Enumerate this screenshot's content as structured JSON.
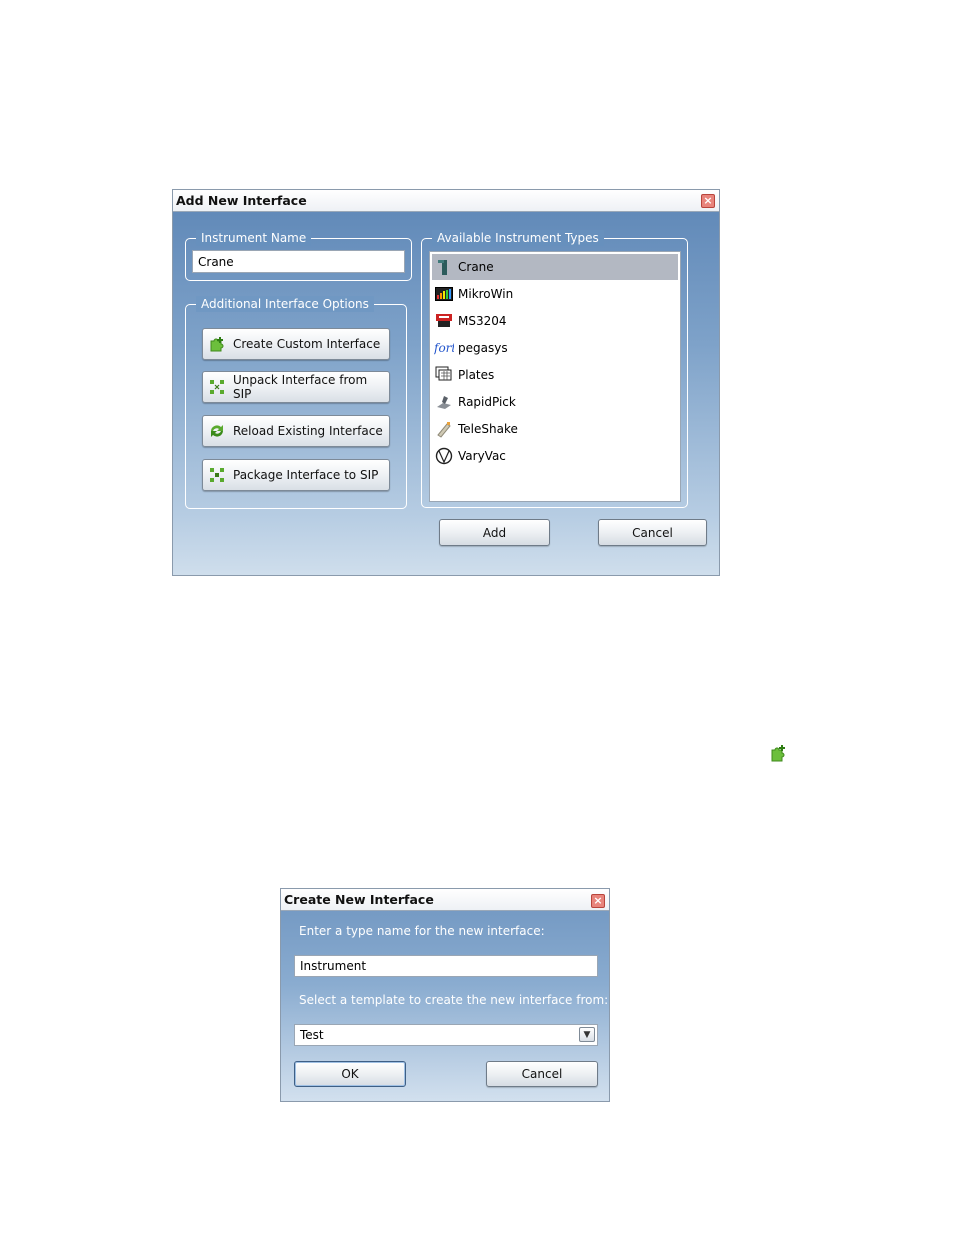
{
  "add_dialog": {
    "title": "Add New Interface",
    "instrument_name_legend": "Instrument Name",
    "instrument_name_value": "Crane",
    "options_legend": "Additional Interface Options",
    "option_buttons": [
      {
        "label": "Create Custom Interface",
        "icon": "puzzle-add-icon"
      },
      {
        "label": "Unpack Interface from SIP",
        "icon": "unpack-icon"
      },
      {
        "label": "Reload Existing Interface",
        "icon": "reload-icon"
      },
      {
        "label": "Package Interface to SIP",
        "icon": "package-icon"
      }
    ],
    "types_legend": "Available Instrument Types",
    "instrument_types": [
      {
        "label": "Crane",
        "icon": "crane-icon",
        "selected": true
      },
      {
        "label": "MikroWin",
        "icon": "mikrowin-icon",
        "selected": false
      },
      {
        "label": "MS3204",
        "icon": "ms3204-icon",
        "selected": false
      },
      {
        "label": "pegasys",
        "icon": "forte-icon",
        "selected": false
      },
      {
        "label": "Plates",
        "icon": "plates-icon",
        "selected": false
      },
      {
        "label": "RapidPick",
        "icon": "rapidpick-icon",
        "selected": false
      },
      {
        "label": "TeleShake",
        "icon": "teleshake-icon",
        "selected": false
      },
      {
        "label": "VaryVac",
        "icon": "varyvac-icon",
        "selected": false
      }
    ],
    "add_label": "Add",
    "cancel_label": "Cancel"
  },
  "create_dialog": {
    "title": "Create New Interface",
    "type_name_prompt": "Enter a type name for the new interface:",
    "type_name_value": "Instrument",
    "template_prompt": "Select a template to create the new interface from:",
    "template_selected": "Test",
    "ok_label": "OK",
    "cancel_label": "Cancel"
  },
  "colors": {
    "dialog_top": "#5d86b6",
    "dialog_bottom": "#cfdeec",
    "selection": "#b3b8c2",
    "close_button": "#e8847c"
  }
}
